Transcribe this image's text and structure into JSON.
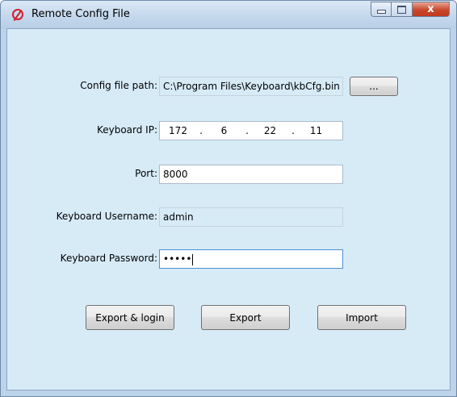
{
  "window": {
    "title": "Remote Config File",
    "close_glyph": "x",
    "icon": "app-logo-icon"
  },
  "form": {
    "config_path": {
      "label": "Config file path:",
      "value": "C:\\Program Files\\Keyboard\\kbCfg.bin",
      "browse_label": "..."
    },
    "keyboard_ip": {
      "label": "Keyboard IP:",
      "octets": [
        "172",
        "6",
        "22",
        "11"
      ],
      "separator": "."
    },
    "port": {
      "label": "Port:",
      "value": "8000"
    },
    "username": {
      "label": "Keyboard Username:",
      "value": "admin"
    },
    "password": {
      "label": "Keyboard Password:",
      "value": "•••••"
    }
  },
  "actions": {
    "export_login": "Export & login",
    "export": "Export",
    "import": "Import"
  },
  "colors": {
    "client_bg": "#d7ebf7",
    "close_button": "#c9472b",
    "focus_border": "#4d8fd6"
  }
}
